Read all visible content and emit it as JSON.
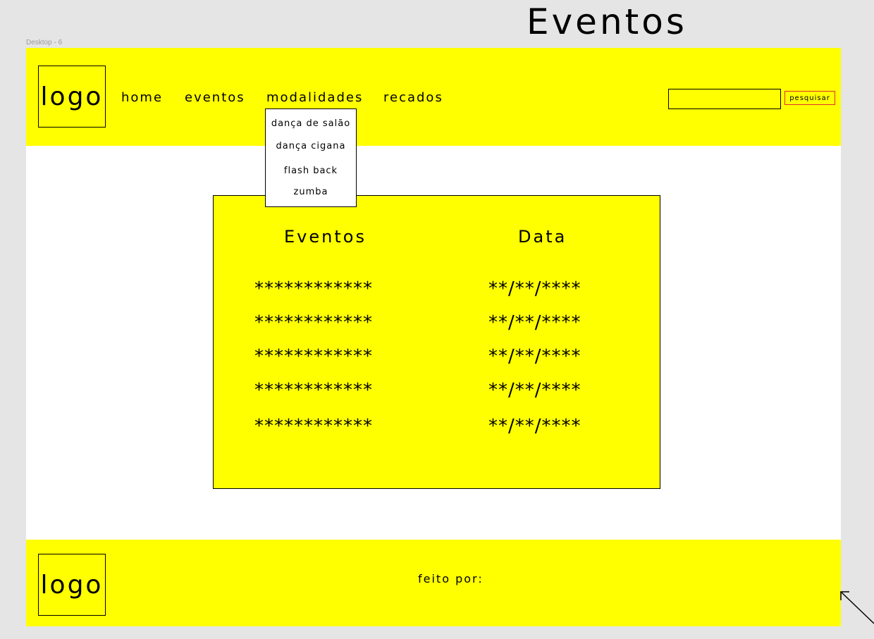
{
  "canvas": {
    "page_title": "Eventos",
    "frame_label": "Desktop - 6"
  },
  "header": {
    "logo": "logo",
    "nav": [
      {
        "label": "home"
      },
      {
        "label": "eventos"
      },
      {
        "label": "modalidades"
      },
      {
        "label": "recados"
      }
    ],
    "search": {
      "value": "",
      "placeholder": "",
      "button": "pesquisar"
    }
  },
  "dropdown": {
    "items": [
      {
        "label": "dança de salão"
      },
      {
        "label": "dança cigana"
      },
      {
        "label": "flash back"
      },
      {
        "label": "zumba"
      }
    ]
  },
  "events": {
    "col_event": "Eventos",
    "col_date": "Data",
    "rows": [
      {
        "name": "************",
        "date": "**/**/****"
      },
      {
        "name": "************",
        "date": "**/**/****"
      },
      {
        "name": "************",
        "date": "**/**/****"
      },
      {
        "name": "************",
        "date": "**/**/****"
      },
      {
        "name": "************",
        "date": "**/**/****"
      }
    ]
  },
  "footer": {
    "logo": "logo",
    "text": "feito por:"
  },
  "colors": {
    "brand_yellow": "#ffff00",
    "canvas_gray": "#e5e5e5",
    "button_border": "#e03030"
  }
}
